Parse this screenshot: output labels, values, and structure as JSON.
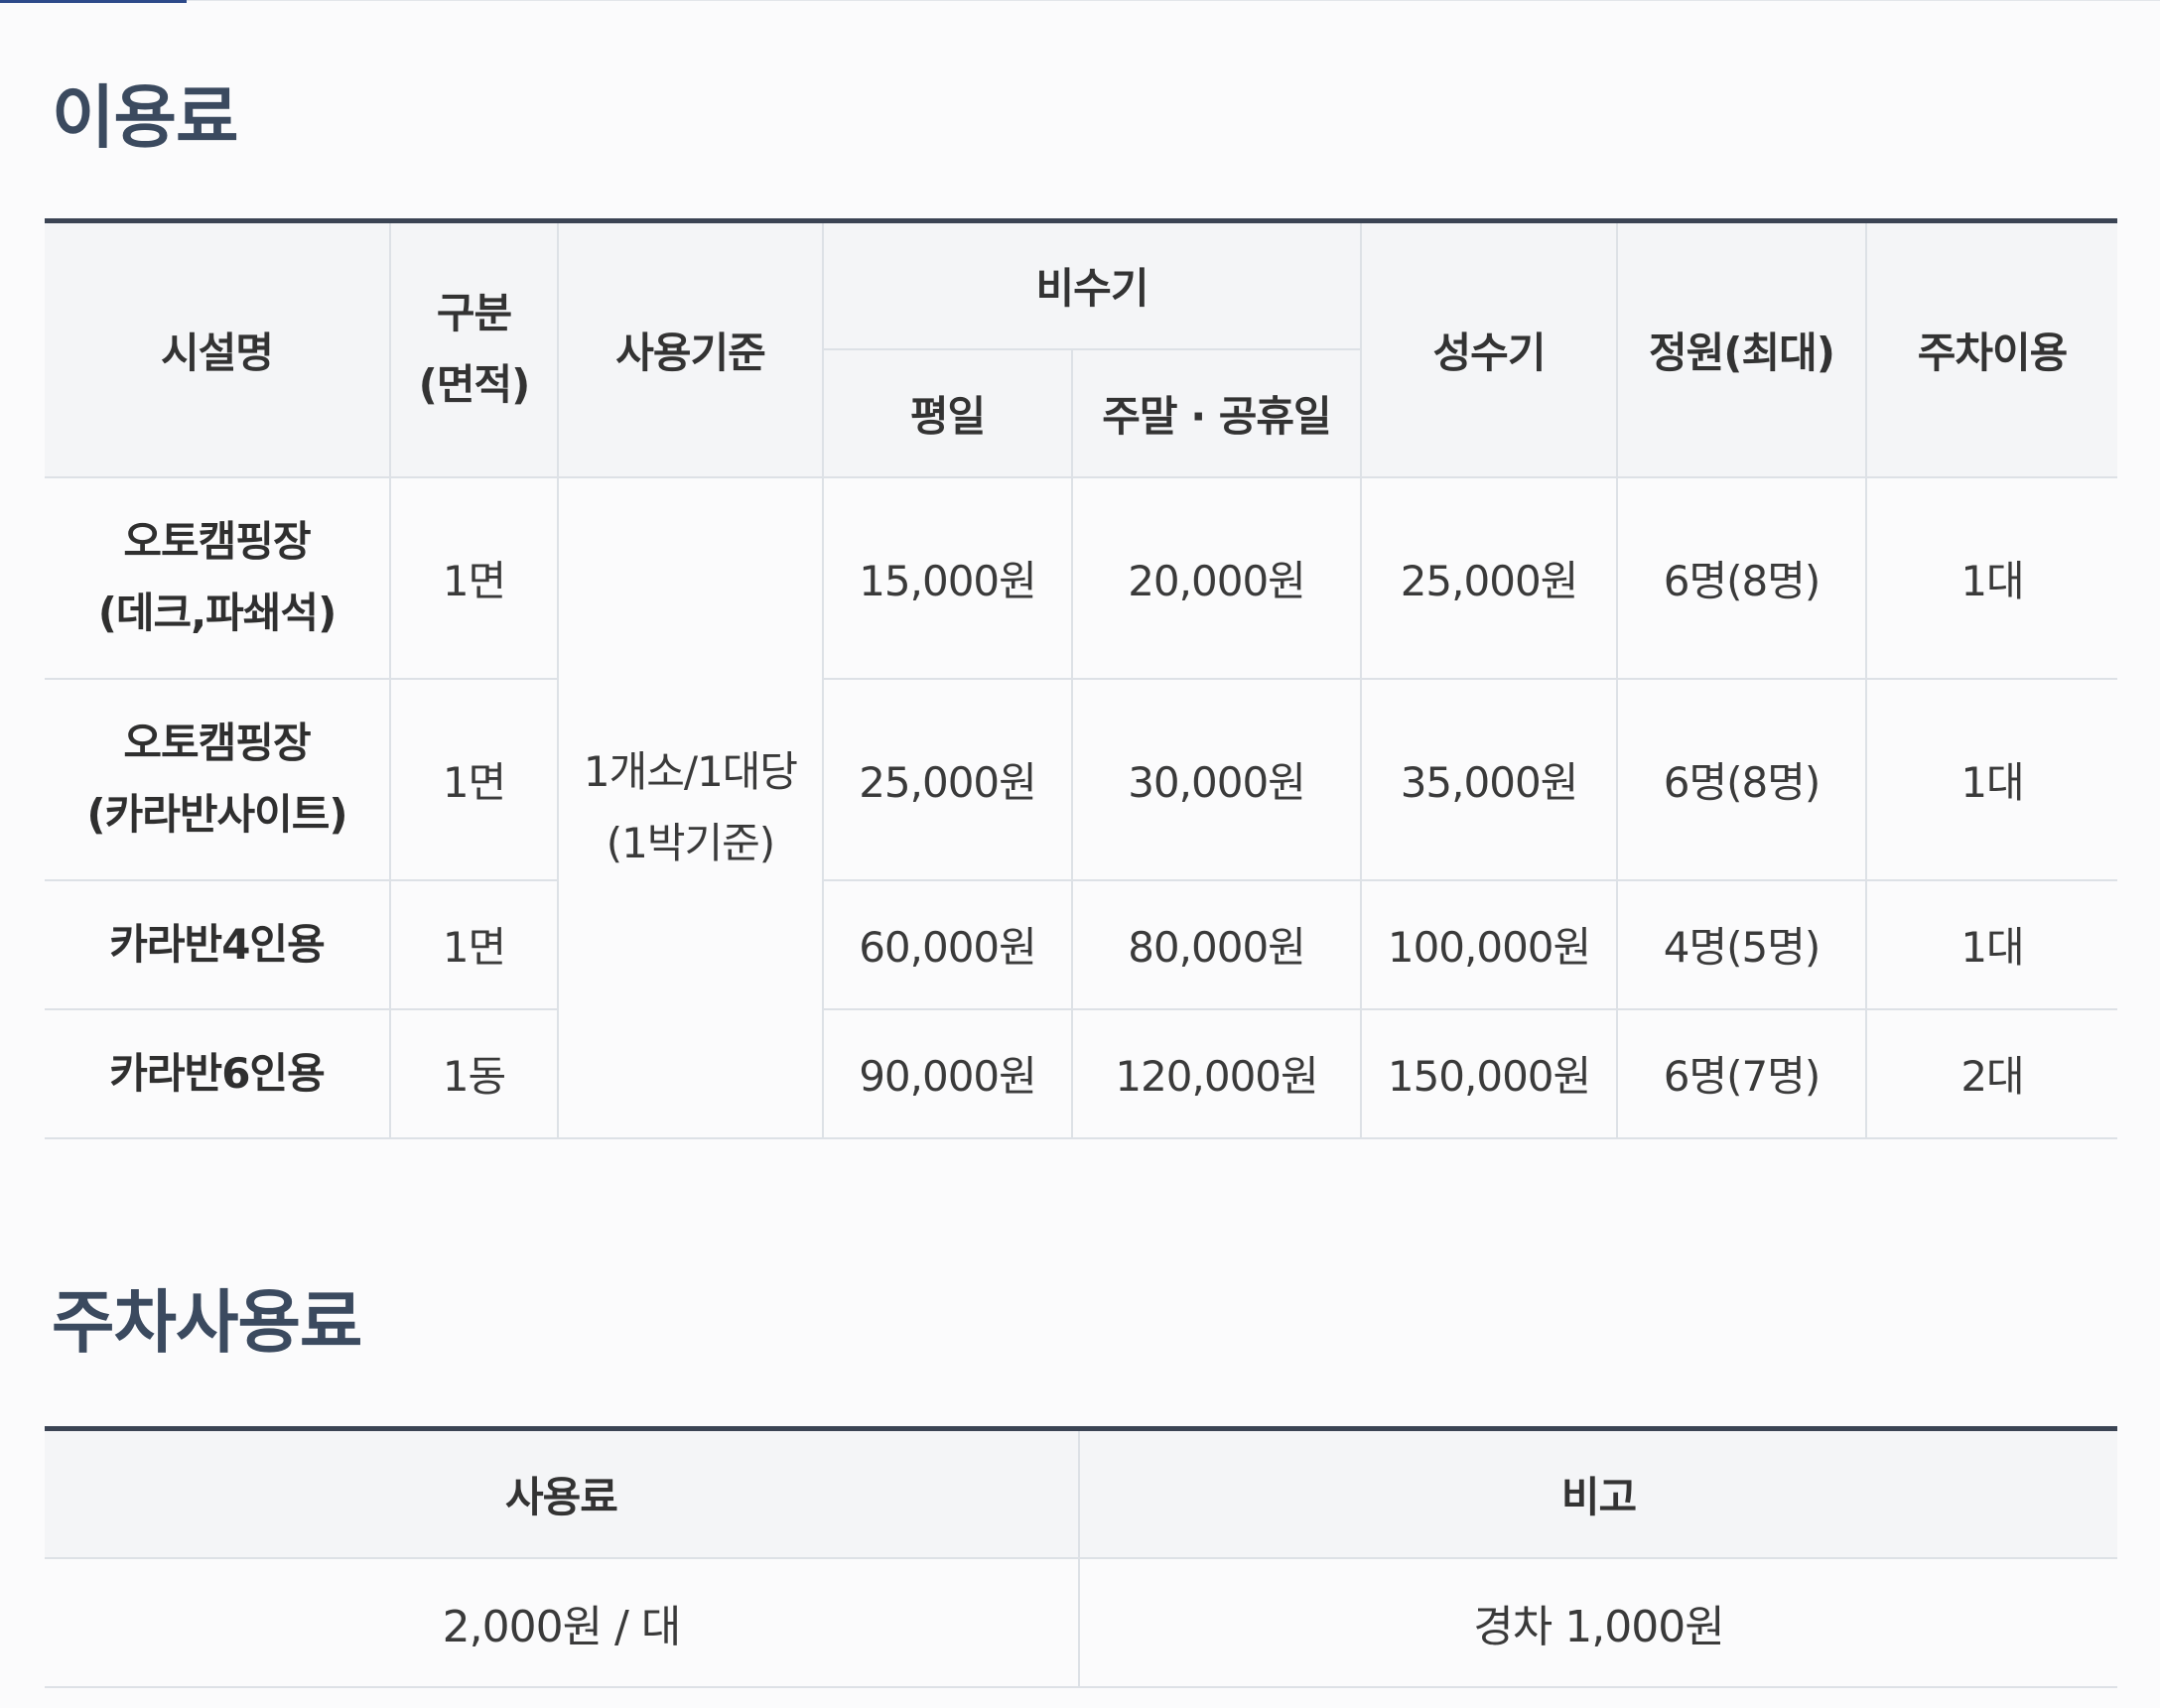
{
  "fee_section": {
    "title": "이용료",
    "headers": {
      "facility": "시설명",
      "division_line1": "구분",
      "division_line2": "(면적)",
      "basis": "사용기준",
      "off_peak": "비수기",
      "weekday": "평일",
      "weekend_holiday": "주말 · 공휴일",
      "peak": "성수기",
      "capacity": "정원(최대)",
      "parking": "주차이용"
    },
    "basis_value_line1": "1개소/1대당",
    "basis_value_line2": "(1박기준)",
    "rows": [
      {
        "facility_line1": "오토캠핑장",
        "facility_line2": "(데크,파쇄석)",
        "division": "1면",
        "weekday": "15,000원",
        "weekend": "20,000원",
        "peak": "25,000원",
        "capacity": "6명(8명)",
        "parking": "1대"
      },
      {
        "facility_line1": "오토캠핑장",
        "facility_line2": "(카라반사이트)",
        "division": "1면",
        "weekday": "25,000원",
        "weekend": "30,000원",
        "peak": "35,000원",
        "capacity": "6명(8명)",
        "parking": "1대"
      },
      {
        "facility_line1": "카라반4인용",
        "division": "1면",
        "weekday": "60,000원",
        "weekend": "80,000원",
        "peak": "100,000원",
        "capacity": "4명(5명)",
        "parking": "1대"
      },
      {
        "facility_line1": "카라반6인용",
        "division": "1동",
        "weekday": "90,000원",
        "weekend": "120,000원",
        "peak": "150,000원",
        "capacity": "6명(7명)",
        "parking": "2대"
      }
    ]
  },
  "parking_section": {
    "title": "주차사용료",
    "headers": {
      "fee": "사용료",
      "note": "비고"
    },
    "rows": [
      {
        "fee": "2,000원 / 대",
        "note": "경차 1,000원"
      }
    ]
  }
}
